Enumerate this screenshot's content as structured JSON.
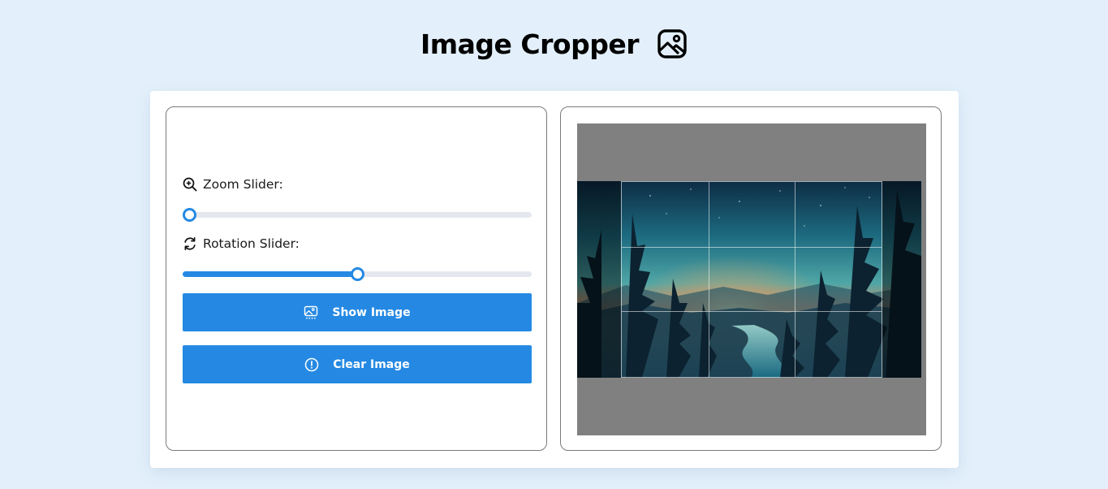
{
  "header": {
    "title": "Image Cropper",
    "icon": "image-icon"
  },
  "controls": {
    "zoom": {
      "label": "Zoom Slider:",
      "icon": "zoom-in-icon",
      "value_fraction": 0.0
    },
    "rotation": {
      "label": "Rotation Slider:",
      "icon": "rotate-icon",
      "value_fraction": 0.5
    },
    "show_button": {
      "label": "Show Image",
      "icon": "image-icon"
    },
    "clear_button": {
      "label": "Clear Image",
      "icon": "alert-circle-icon"
    }
  },
  "colors": {
    "background": "#e3f0fb",
    "accent": "#2589e3",
    "crop_backdrop": "#808080"
  }
}
